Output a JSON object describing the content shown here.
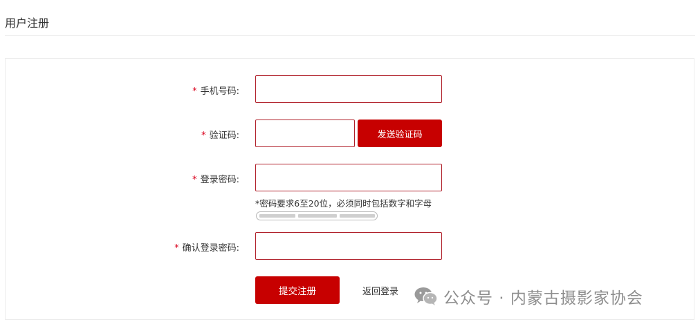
{
  "page": {
    "title": "用户注册"
  },
  "form": {
    "phone_label": "手机号码:",
    "code_label": "验证码:",
    "password_label": "登录密码:",
    "confirm_label": "确认登录密码:",
    "required_mark": "*",
    "send_code_button": "发送验证码",
    "password_hint": "*密码要求6至20位，必须同时包括数字和字母",
    "password_strength_segments": 3,
    "submit_button": "提交注册",
    "back_to_login": "返回登录"
  },
  "watermark": {
    "text": "公众号 · 内蒙古摄影家协会",
    "icon": "wechat-icon"
  },
  "colors": {
    "primary": "#c70000",
    "required": "#d9001b",
    "input_border": "#b0202a"
  }
}
